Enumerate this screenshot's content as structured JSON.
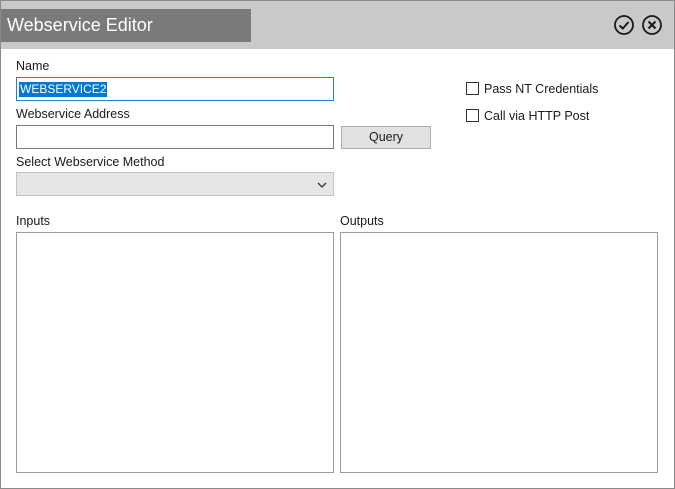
{
  "window": {
    "title": "Webservice Editor"
  },
  "titlebar": {
    "ok_icon": "check-circle-icon",
    "close_icon": "close-circle-icon"
  },
  "form": {
    "name_label": "Name",
    "name_value": "WEBSERVICE2",
    "address_label": "Webservice Address",
    "address_value": "",
    "query_label": "Query",
    "method_label": "Select Webservice Method",
    "method_value": "",
    "pass_nt_label": "Pass NT Credentials",
    "pass_nt_checked": false,
    "http_post_label": "Call via HTTP Post",
    "http_post_checked": false,
    "inputs_label": "Inputs",
    "outputs_label": "Outputs"
  },
  "colors": {
    "titlebar_bg": "#c9c9c9",
    "title_box_bg": "#7a7a7a",
    "selection": "#0078d7",
    "focus_border": "#2a7fd4"
  }
}
